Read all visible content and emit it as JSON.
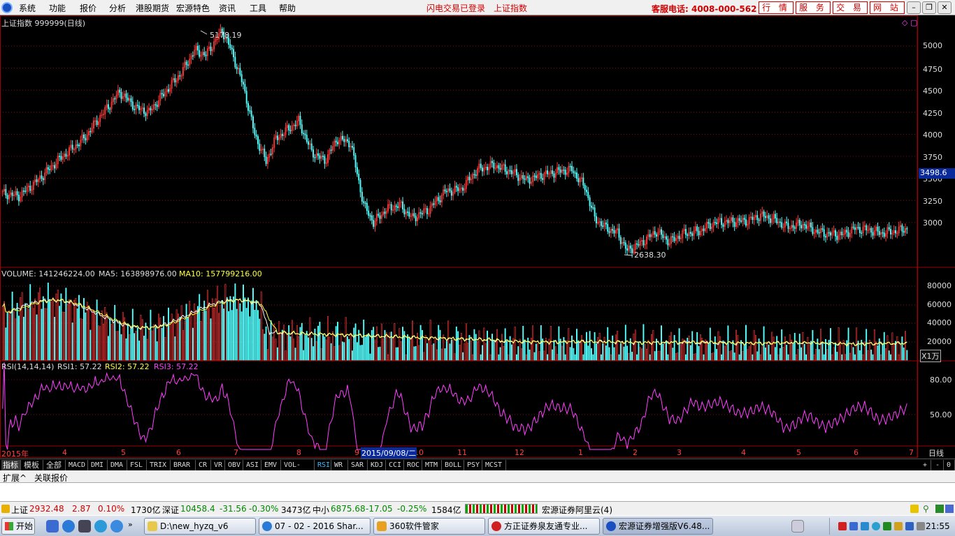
{
  "menu": {
    "items": [
      "系统",
      "功能",
      "报价",
      "分析",
      "港股期货",
      "宏源特色",
      "资讯",
      "工具",
      "帮助"
    ],
    "flash_login": "闪电交易已登录",
    "index_label": "上证指数",
    "hotline": "客服电话: 4008-000-562",
    "buttons": [
      "行 情",
      "服 务",
      "交 易",
      "网 站"
    ]
  },
  "price_pane": {
    "caption": "上证指数 999999(日线)",
    "high_label": "5178.19",
    "low_label": "2638.30",
    "current_price": "3498.6",
    "yaxis_ticks": [
      "5000",
      "4750",
      "4500",
      "4250",
      "4000",
      "3750",
      "3500",
      "3250",
      "3000"
    ]
  },
  "volume_pane": {
    "label": "VOLUME: 141246224.00",
    "ma5": "MA5: 163898976.00",
    "ma10": "MA10: 157799216.00",
    "yaxis_ticks": [
      "80000",
      "60000",
      "40000",
      "20000"
    ],
    "unit": "X1万"
  },
  "rsi_pane": {
    "label": "RSI(14,14,14)",
    "rsi1": "RSI1: 57.22",
    "rsi2": "RSI2: 57.22",
    "rsi3": "RSI3: 57.22",
    "yaxis_ticks": [
      "80.00",
      "50.00"
    ]
  },
  "x_axis": {
    "year_label": "2015年",
    "months": [
      "4",
      "5",
      "6",
      "7",
      "8",
      "9",
      "10",
      "11",
      "12",
      "1",
      "2",
      "3",
      "4",
      "5",
      "6",
      "7"
    ],
    "cursor_date": "2015/09/08/二",
    "period": "日线"
  },
  "chart_data": {
    "type": "candlestick",
    "title": "上证指数 999999(日线)",
    "ylim": [
      2500,
      5300
    ],
    "close_path": [
      [
        0,
        3330
      ],
      [
        10,
        3300
      ],
      [
        20,
        3450
      ],
      [
        35,
        3720
      ],
      [
        50,
        3950
      ],
      [
        60,
        4200
      ],
      [
        72,
        4480
      ],
      [
        82,
        4300
      ],
      [
        90,
        4250
      ],
      [
        100,
        4480
      ],
      [
        110,
        4700
      ],
      [
        118,
        4950
      ],
      [
        125,
        4900
      ],
      [
        135,
        5178
      ],
      [
        140,
        4980
      ],
      [
        148,
        4550
      ],
      [
        155,
        4000
      ],
      [
        162,
        3690
      ],
      [
        168,
        3950
      ],
      [
        175,
        4050
      ],
      [
        182,
        4150
      ],
      [
        190,
        3800
      ],
      [
        198,
        3700
      ],
      [
        206,
        3950
      ],
      [
        214,
        3900
      ],
      [
        222,
        3200
      ],
      [
        228,
        3000
      ],
      [
        236,
        3150
      ],
      [
        244,
        3200
      ],
      [
        252,
        3050
      ],
      [
        262,
        3150
      ],
      [
        272,
        3350
      ],
      [
        282,
        3380
      ],
      [
        292,
        3600
      ],
      [
        302,
        3650
      ],
      [
        312,
        3580
      ],
      [
        322,
        3480
      ],
      [
        332,
        3540
      ],
      [
        342,
        3580
      ],
      [
        350,
        3600
      ],
      [
        358,
        3400
      ],
      [
        364,
        3050
      ],
      [
        370,
        2950
      ],
      [
        378,
        2880
      ],
      [
        384,
        2680
      ],
      [
        392,
        2760
      ],
      [
        402,
        2900
      ],
      [
        410,
        2780
      ],
      [
        418,
        2870
      ],
      [
        428,
        2900
      ],
      [
        438,
        3000
      ],
      [
        448,
        3010
      ],
      [
        458,
        3020
      ],
      [
        466,
        3080
      ],
      [
        474,
        3040
      ],
      [
        482,
        2950
      ],
      [
        492,
        2980
      ],
      [
        500,
        2900
      ],
      [
        508,
        2870
      ],
      [
        516,
        2860
      ],
      [
        524,
        2930
      ],
      [
        532,
        2920
      ],
      [
        540,
        2880
      ],
      [
        548,
        2900
      ],
      [
        556,
        2932
      ]
    ]
  },
  "tabs": {
    "items": [
      "指标",
      "模板",
      "全部",
      "MACD",
      "DMI",
      "DMA",
      "FSL",
      "TRIX",
      "BRAR",
      "CR",
      "VR",
      "OBV",
      "ASI",
      "EMV",
      "VOL-TDX",
      "RSI",
      "WR",
      "SAR",
      "KDJ",
      "CCI",
      "ROC",
      "MTM",
      "BOLL",
      "PSY",
      "MCST"
    ],
    "right": [
      "+",
      "-",
      "0"
    ]
  },
  "ext": [
    "扩展^",
    "关联报价"
  ],
  "status": {
    "sh_name": "上证",
    "sh_value": "2932.48",
    "sh_change": "2.87",
    "sh_pct": "0.10%",
    "sh_amount": "1730亿",
    "sz_name": "深证",
    "sz_value": "10458.4",
    "sz_change": "-31.56",
    "sz_pct": "-0.30%",
    "sz_amount": "3473亿",
    "zx_name": "中小",
    "zx_value": "6875.68",
    "zx_change": "-17.05",
    "zx_pct": "-0.25%",
    "zx_amount": "1584亿",
    "server": "宏源证券阿里云(4)"
  },
  "taskbar": {
    "start": "开始",
    "tasks": [
      "D:\\new_hyzq_v6",
      "07 - 02 - 2016 Shar...",
      "360软件管家",
      "方正证券泉友通专业...",
      "宏源证券增强版V6.48..."
    ],
    "clock": "21:55"
  }
}
